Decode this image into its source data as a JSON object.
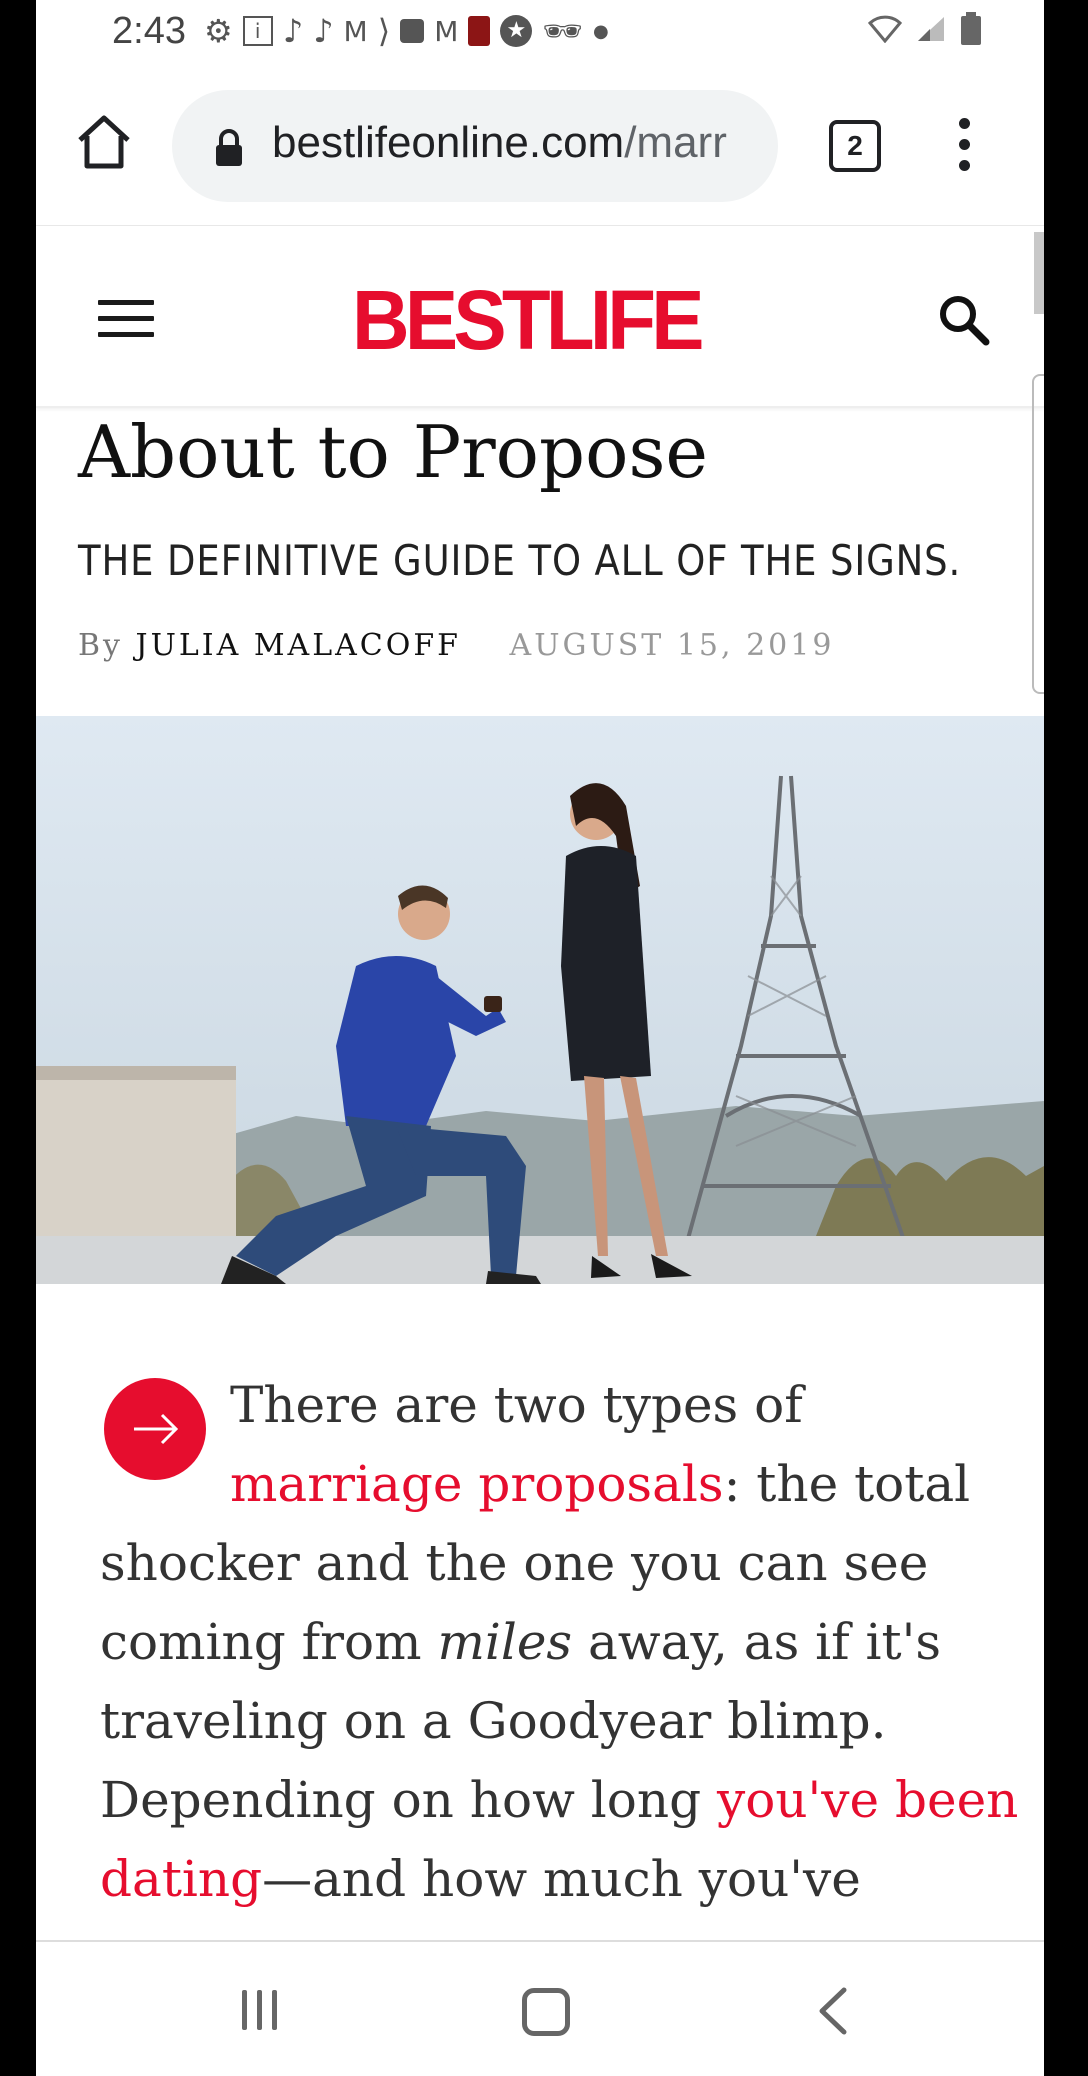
{
  "status_bar": {
    "time": "2:43",
    "notification_icons": [
      "settings-icon",
      "info-icon",
      "tiktok-icon",
      "tiktok-icon",
      "gmail-icon",
      "sprint-icon",
      "clock-icon",
      "gmail-icon",
      "stanford-icon",
      "star-icon",
      "incognito-icon",
      "dot-icon"
    ],
    "system_icons": [
      "wifi-icon",
      "signal-icon",
      "battery-icon"
    ]
  },
  "browser": {
    "url_host": "bestlifeonline.com",
    "url_path": "/marr",
    "tab_count": "2"
  },
  "site": {
    "logo": "BESTLIFE",
    "brand_color": "#e60d2e"
  },
  "article": {
    "headline_visible": "About to Propose",
    "dek": "THE DEFINITIVE GUIDE TO ALL OF THE SIGNS.",
    "byline_prefix": "By",
    "author": "JULIA MALACOFF",
    "date": "AUGUST 15, 2019",
    "body": {
      "l1": "There are two types of",
      "l2_link": "marriage proposals",
      "l2_rest": ": the total",
      "l3": "shocker and the one you can see",
      "l4_pre": "coming from ",
      "l4_em": "miles",
      "l4_post": " away, as if it's",
      "l5": "traveling on a Goodyear blimp.",
      "l6_pre": "Depending on how long ",
      "l6_link": "you've been",
      "l7_link": "dating",
      "l7_rest": "—and how much you've"
    }
  }
}
